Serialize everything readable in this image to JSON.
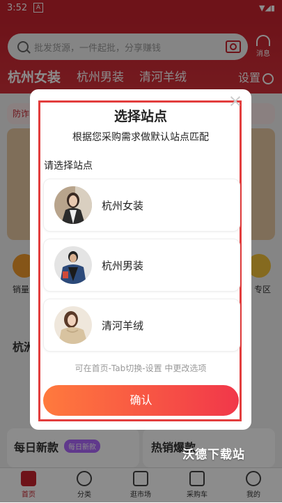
{
  "status_bar": {
    "time": "3:52",
    "badge": "A"
  },
  "search": {
    "placeholder": "批发货源，一件起批，分享赚钱"
  },
  "header": {
    "message_label": "消息",
    "settings_label": "设置"
  },
  "tabs": [
    {
      "label": "杭州女装"
    },
    {
      "label": "杭州男装"
    },
    {
      "label": "清河羊绒"
    }
  ],
  "background": {
    "tag": "防诈",
    "left_label": "销量",
    "right_label": "专区",
    "section_left": "杭洲",
    "daily_new": "每日新款",
    "daily_new_pill": "每日新款",
    "hot": "热销爆款"
  },
  "dialog": {
    "title": "选择站点",
    "subtitle": "根据您采购需求做默认站点匹配",
    "select_label": "请选择站点",
    "options": [
      {
        "label": "杭州女装"
      },
      {
        "label": "杭州男装"
      },
      {
        "label": "清河羊绒"
      }
    ],
    "hint": "可在首页-Tab切换-设置 中更改选项",
    "confirm": "确认"
  },
  "bottom_nav": [
    {
      "label": "首页"
    },
    {
      "label": "分类"
    },
    {
      "label": "逛市场"
    },
    {
      "label": "采购车"
    },
    {
      "label": "我的"
    }
  ],
  "watermark": "沃德下载站",
  "colors": {
    "accent": "#c8232f",
    "confirm_start": "#ff7a3d",
    "confirm_end": "#f1374a"
  }
}
